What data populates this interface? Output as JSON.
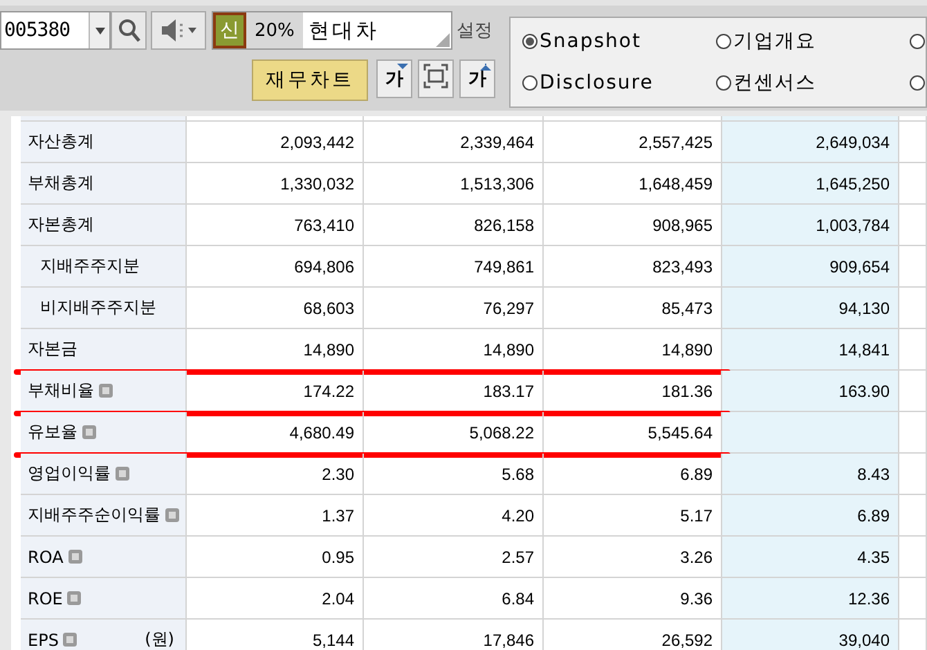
{
  "toolbar": {
    "stock_code": "005380",
    "badge": "신",
    "ratio": "20%",
    "stock_name": "현대차",
    "settings_label": "설정",
    "chart_button": "재무차트",
    "font_buttons": [
      {
        "label": "가",
        "kind": "decrease"
      },
      {
        "label": "가",
        "kind": "increase"
      }
    ]
  },
  "view_options": [
    {
      "label": "Snapshot",
      "selected": true
    },
    {
      "label": "기업개요",
      "selected": false
    },
    {
      "selected": false
    },
    {
      "label": "Disclosure",
      "selected": false
    },
    {
      "label": "컨센서스",
      "selected": false
    },
    {
      "selected": false
    }
  ],
  "table": {
    "rows": [
      {
        "label": "자산총계",
        "indent": false,
        "help": false,
        "underlined": false,
        "values": [
          "2,093,442",
          "2,339,464",
          "2,557,425",
          "2,649,034"
        ]
      },
      {
        "label": "부채총계",
        "indent": false,
        "help": false,
        "underlined": false,
        "values": [
          "1,330,032",
          "1,513,306",
          "1,648,459",
          "1,645,250"
        ]
      },
      {
        "label": "자본총계",
        "indent": false,
        "help": false,
        "underlined": false,
        "values": [
          "763,410",
          "826,158",
          "908,965",
          "1,003,784"
        ]
      },
      {
        "label": "지배주주지분",
        "indent": true,
        "help": false,
        "underlined": false,
        "values": [
          "694,806",
          "749,861",
          "823,493",
          "909,654"
        ]
      },
      {
        "label": "비지배주주지분",
        "indent": true,
        "help": false,
        "underlined": false,
        "values": [
          "68,603",
          "76,297",
          "85,473",
          "94,130"
        ]
      },
      {
        "label": "자본금",
        "indent": false,
        "help": false,
        "underlined": true,
        "values": [
          "14,890",
          "14,890",
          "14,890",
          "14,841"
        ]
      },
      {
        "label": "부채비율",
        "indent": false,
        "help": true,
        "underlined": true,
        "values": [
          "174.22",
          "183.17",
          "181.36",
          "163.90"
        ]
      },
      {
        "label": "유보율",
        "indent": false,
        "help": true,
        "underlined": true,
        "values": [
          "4,680.49",
          "5,068.22",
          "5,545.64"
        ]
      },
      {
        "label": "영업이익률",
        "indent": false,
        "help": true,
        "underlined": false,
        "values": [
          "2.30",
          "5.68",
          "6.89",
          "8.43"
        ]
      },
      {
        "label": "지배주주순이익률",
        "indent": false,
        "help": true,
        "underlined": false,
        "values": [
          "1.37",
          "4.20",
          "5.17",
          "6.89"
        ]
      },
      {
        "label": "ROA",
        "indent": false,
        "help": true,
        "underlined": false,
        "values": [
          "0.95",
          "2.57",
          "3.26",
          "4.35"
        ]
      },
      {
        "label": "ROE",
        "indent": false,
        "help": true,
        "underlined": false,
        "values": [
          "2.04",
          "6.84",
          "9.36",
          "12.36"
        ]
      },
      {
        "label": "EPS",
        "unit": "(원)",
        "indent": false,
        "help": true,
        "underlined": false,
        "values": [
          "5,144",
          "17,846",
          "26,592",
          "39,040"
        ]
      }
    ]
  }
}
